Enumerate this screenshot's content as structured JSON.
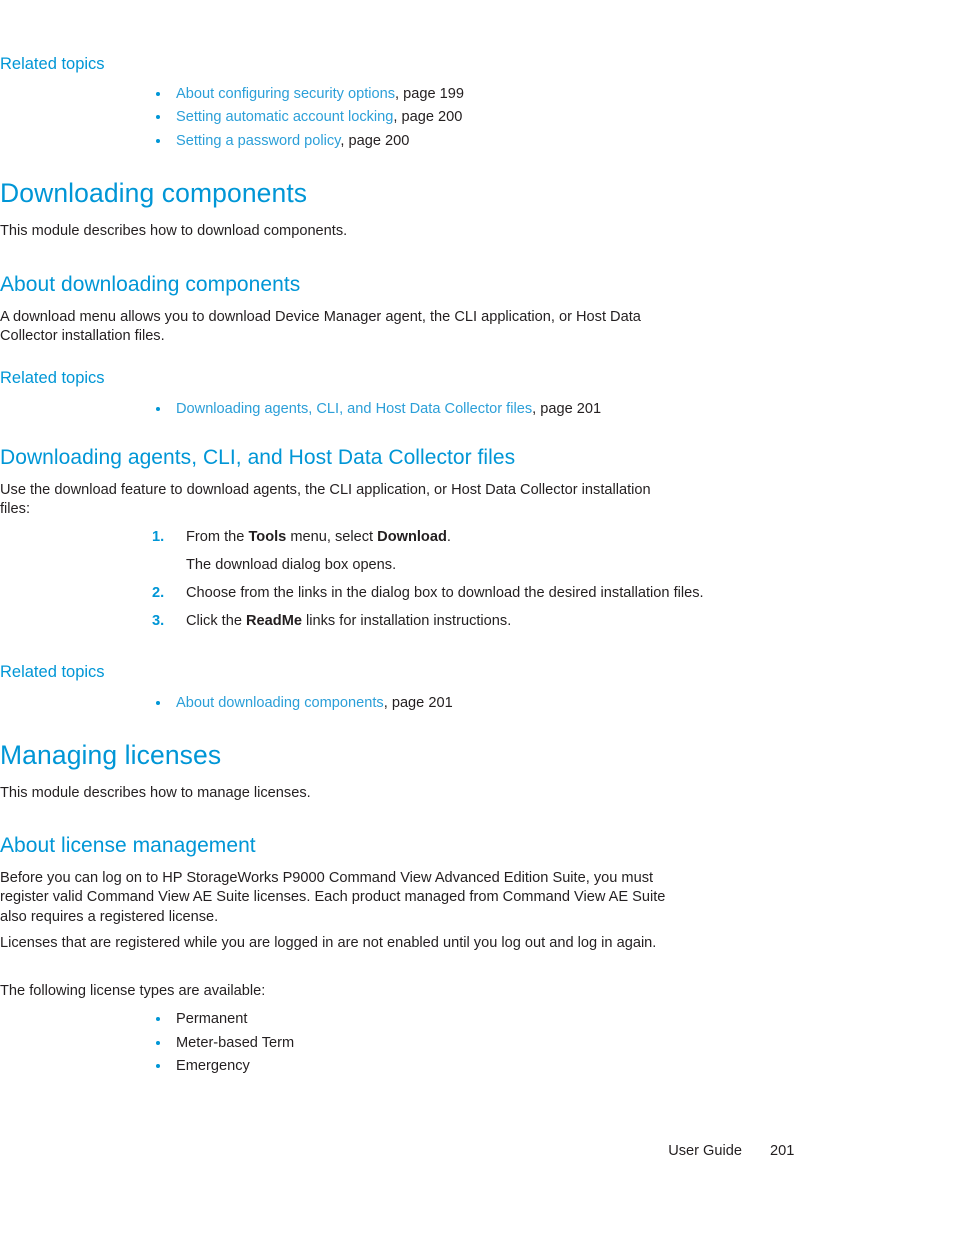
{
  "page": {
    "footer_label": "User Guide",
    "footer_page_number": "201",
    "accent_color": "#0096d6",
    "link_color": "#2b9fd8",
    "text_color": "#231f20",
    "background_color": "#ffffff"
  },
  "related_topics_label": "Related topics",
  "sections": {
    "top_related": {
      "heading": "Related topics",
      "links": [
        {
          "text": "About configuring security options",
          "page": ", page 199"
        },
        {
          "text": "Setting automatic account locking",
          "page": ", page 200"
        },
        {
          "text": "Setting a password policy",
          "page": ", page 200"
        }
      ]
    },
    "downloading_components": {
      "heading": "Downloading components",
      "intro": "This module describes how to download components."
    },
    "about_downloading_components": {
      "heading": "About downloading components",
      "paragraph": "A download menu allows you to download Device Manager agent, the CLI application, or Host Data Collector installation files.",
      "related_heading": "Related topics",
      "links": [
        {
          "text": "Downloading agents, CLI, and Host Data Collector files",
          "page": ", page 201"
        }
      ]
    },
    "downloading_agents": {
      "heading": "Downloading agents, CLI, and Host Data Collector files",
      "paragraph": "Use the download feature to download agents, the CLI application, or Host Data Collector installation files:",
      "steps": [
        {
          "number": "1.",
          "parts": [
            {
              "text": "From the ",
              "bold": false
            },
            {
              "text": "Tools",
              "bold": true
            },
            {
              "text": " menu, select ",
              "bold": false
            },
            {
              "text": "Download",
              "bold": true
            },
            {
              "text": ".",
              "bold": false
            }
          ],
          "note": "The download dialog box opens."
        },
        {
          "number": "2.",
          "parts": [
            {
              "text": "Choose from the links in the dialog box to download the desired installation files.",
              "bold": false
            }
          ]
        },
        {
          "number": "3.",
          "parts": [
            {
              "text": "Click the ",
              "bold": false
            },
            {
              "text": "ReadMe",
              "bold": true
            },
            {
              "text": " links for installation instructions.",
              "bold": false
            }
          ]
        }
      ],
      "related_heading": "Related topics",
      "links": [
        {
          "text": "About downloading components",
          "page": ", page 201"
        }
      ]
    },
    "managing_licenses": {
      "heading": "Managing licenses",
      "intro": "This module describes how to manage licenses."
    },
    "about_license_management": {
      "heading": "About license management",
      "paragraph1": "Before you can log on to HP StorageWorks P9000 Command View Advanced Edition Suite, you must register valid Command View AE Suite licenses. Each product managed from Command View AE Suite also requires a registered license.",
      "paragraph2": "Licenses that are registered while you are logged in are not enabled until you log out and log in again.",
      "paragraph3": "The following license types are available:",
      "license_types": [
        "Permanent",
        "Meter-based Term",
        "Emergency"
      ]
    }
  }
}
